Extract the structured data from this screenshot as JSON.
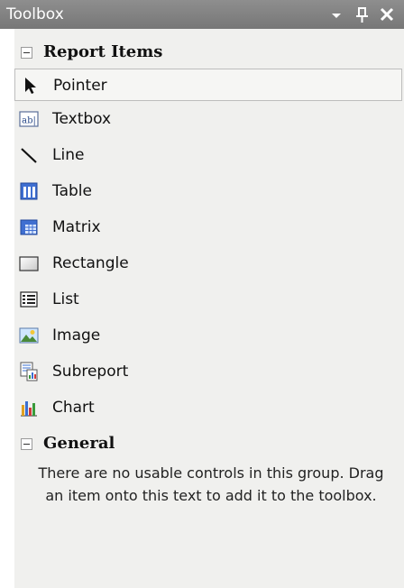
{
  "window": {
    "title": "Toolbox",
    "dropdown_glyph": "▾",
    "pin_glyph": "ᵖ",
    "close_glyph": "✕"
  },
  "groups": {
    "report_items": {
      "label": "Report Items",
      "items": [
        {
          "label": "Pointer",
          "icon": "pointer-icon",
          "selected": true
        },
        {
          "label": "Textbox",
          "icon": "textbox-icon"
        },
        {
          "label": "Line",
          "icon": "line-icon"
        },
        {
          "label": "Table",
          "icon": "table-icon"
        },
        {
          "label": "Matrix",
          "icon": "matrix-icon"
        },
        {
          "label": "Rectangle",
          "icon": "rectangle-icon"
        },
        {
          "label": "List",
          "icon": "list-icon"
        },
        {
          "label": "Image",
          "icon": "image-icon"
        },
        {
          "label": "Subreport",
          "icon": "subreport-icon"
        },
        {
          "label": "Chart",
          "icon": "chart-icon"
        }
      ]
    },
    "general": {
      "label": "General",
      "empty_message": "There are no usable controls in this group. Drag an item onto this text to add it to the toolbox."
    }
  },
  "colors": {
    "titlebar": "#808080",
    "panel": "#f0f0ee",
    "selected_border": "#bdbdbd"
  }
}
